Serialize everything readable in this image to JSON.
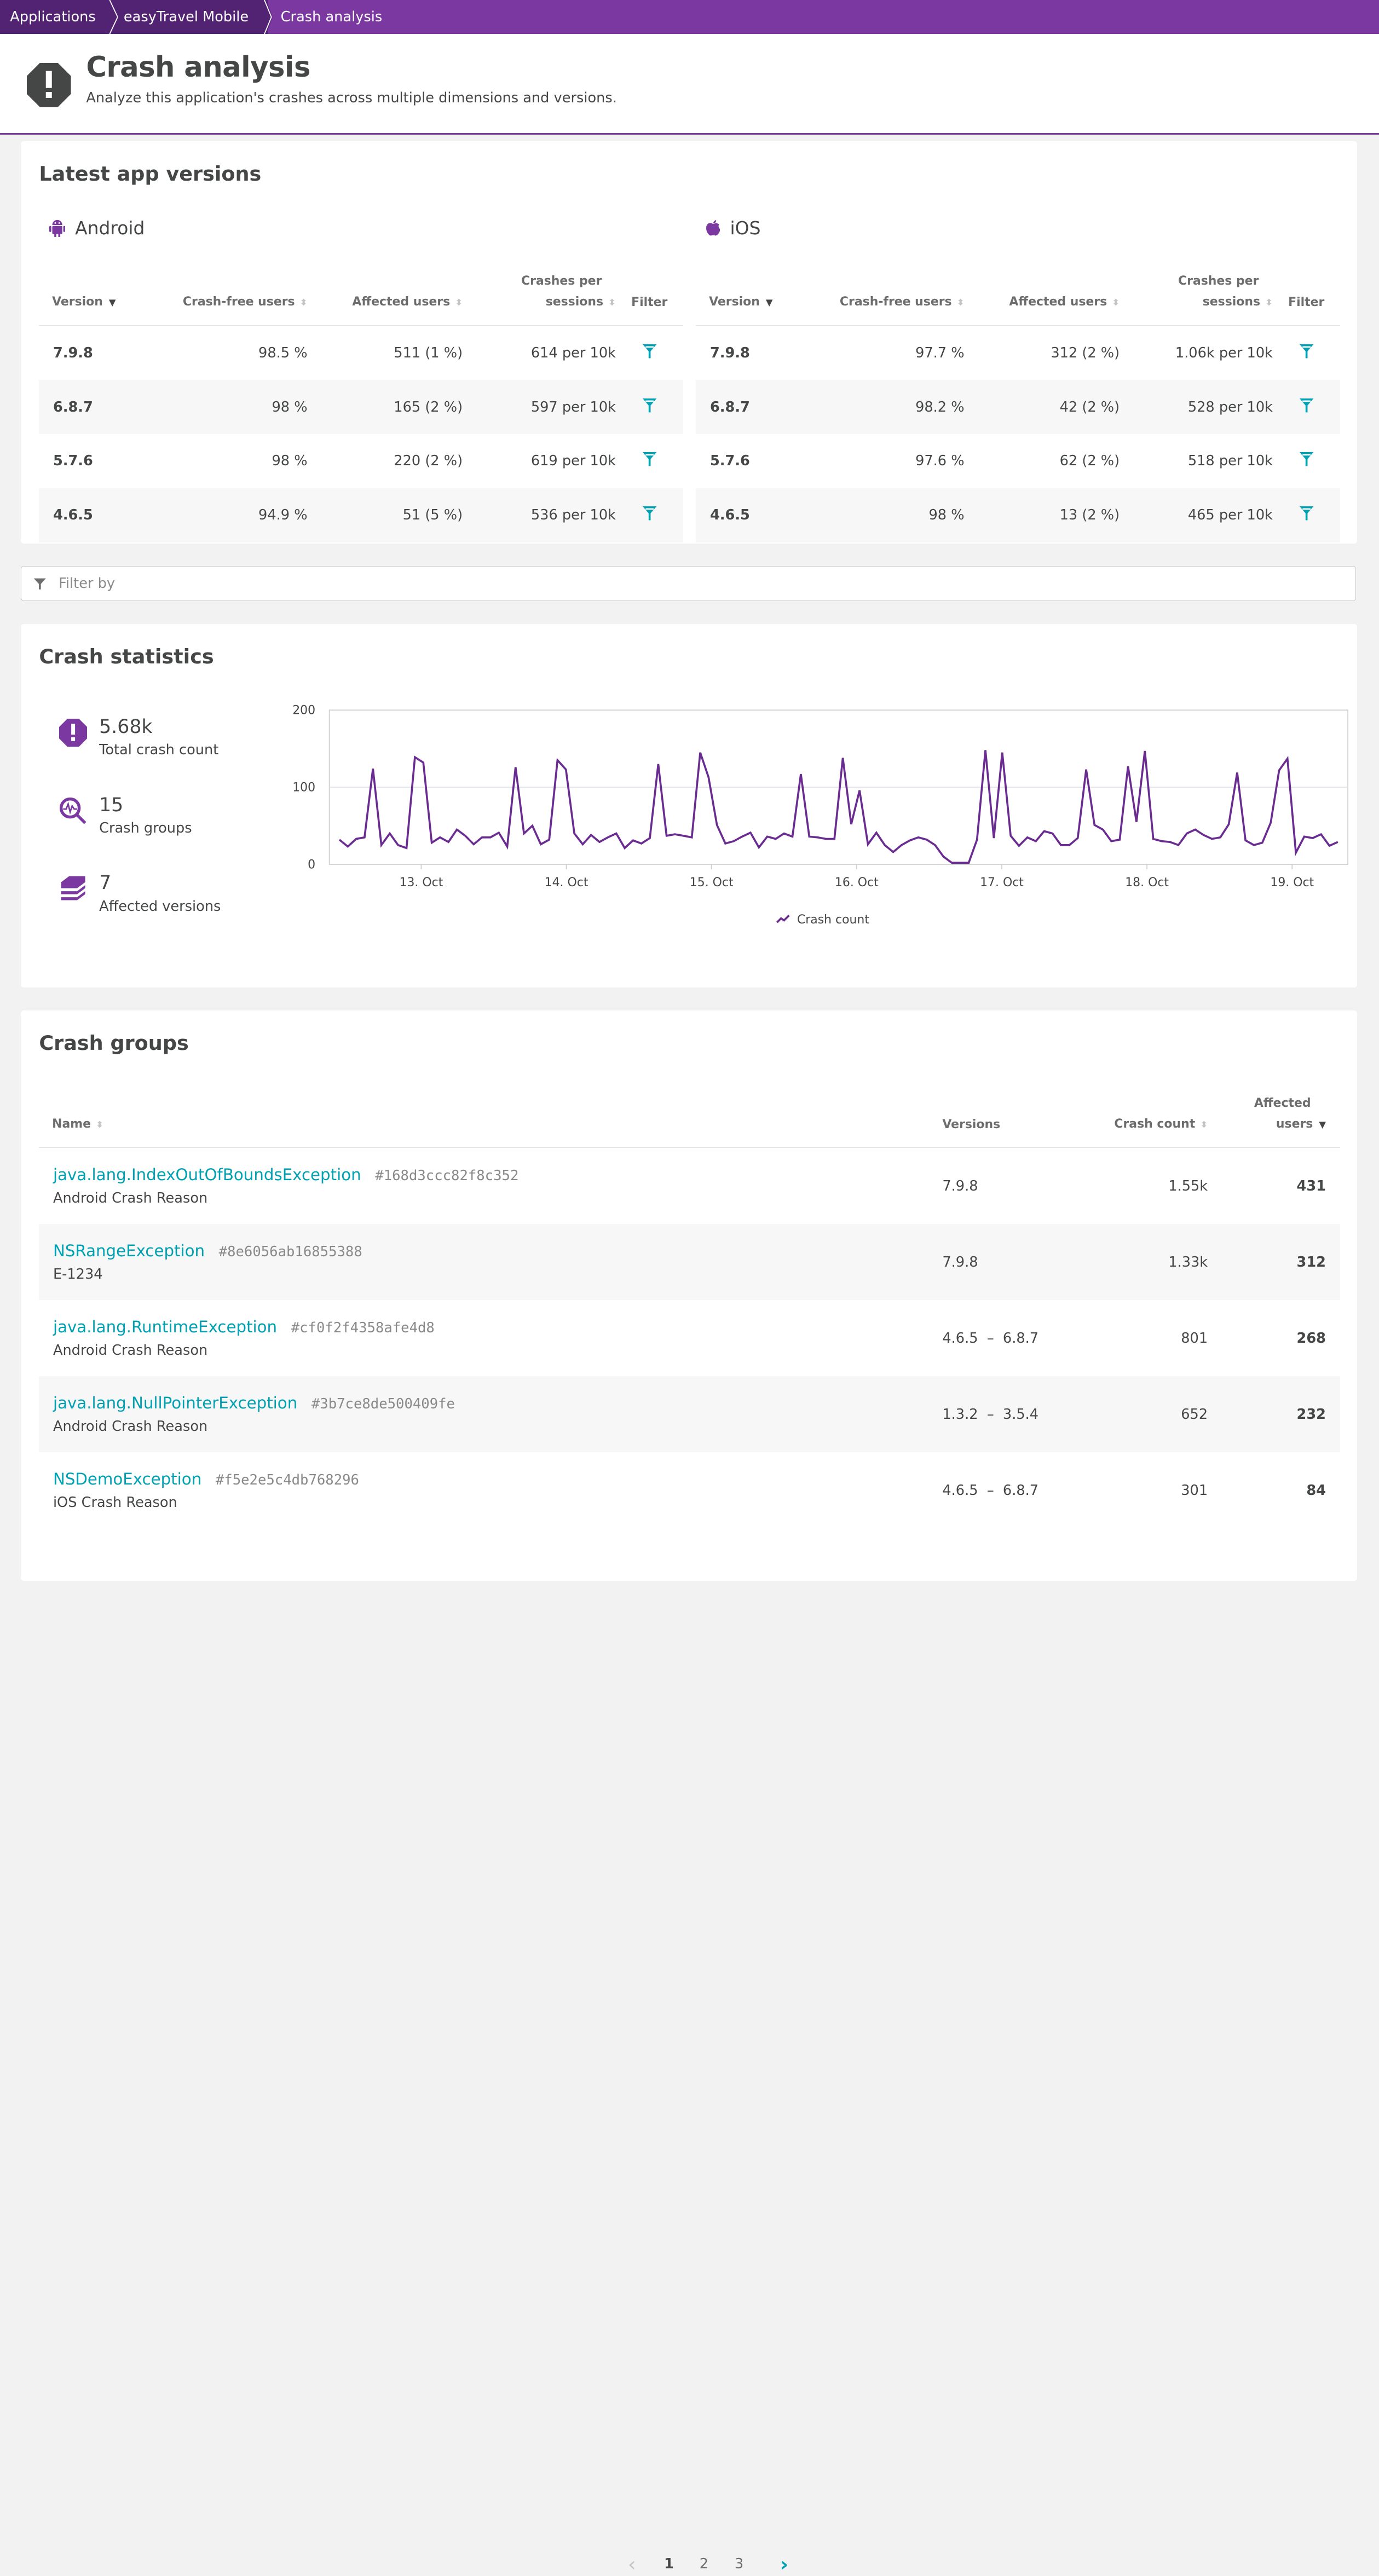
{
  "breadcrumb": [
    "Applications",
    "easyTravel Mobile",
    "Crash analysis"
  ],
  "header": {
    "title": "Crash analysis",
    "subtitle": "Analyze this application's crashes across multiple dimensions and versions."
  },
  "colors": {
    "brand": "#7c38a1",
    "brand_dark": "#522273",
    "link": "#00a1b2",
    "chart_line": "#6a2c91"
  },
  "latest_versions": {
    "title": "Latest app versions",
    "columns": [
      "Version",
      "Crash-free users",
      "Affected users",
      "Crashes per",
      "sessions",
      "Filter"
    ],
    "android": {
      "label": "Android",
      "rows": [
        {
          "version": "7.9.8",
          "crash_free": "98.5 %",
          "affected": "511 (1 %)",
          "per_sessions": "614 per 10k"
        },
        {
          "version": "6.8.7",
          "crash_free": "98 %",
          "affected": "165 (2 %)",
          "per_sessions": "597 per 10k"
        },
        {
          "version": "5.7.6",
          "crash_free": "98 %",
          "affected": "220 (2 %)",
          "per_sessions": "619 per 10k"
        },
        {
          "version": "4.6.5",
          "crash_free": "94.9 %",
          "affected": "51 (5 %)",
          "per_sessions": "536 per 10k"
        }
      ]
    },
    "ios": {
      "label": "iOS",
      "rows": [
        {
          "version": "7.9.8",
          "crash_free": "97.7 %",
          "affected": "312 (2 %)",
          "per_sessions": "1.06k per 10k"
        },
        {
          "version": "6.8.7",
          "crash_free": "98.2 %",
          "affected": "42 (2 %)",
          "per_sessions": "528 per 10k"
        },
        {
          "version": "5.7.6",
          "crash_free": "97.6 %",
          "affected": "62 (2 %)",
          "per_sessions": "518 per 10k"
        },
        {
          "version": "4.6.5",
          "crash_free": "98 %",
          "affected": "13 (2 %)",
          "per_sessions": "465 per 10k"
        }
      ]
    }
  },
  "filter": {
    "placeholder": "Filter by"
  },
  "crash_statistics": {
    "title": "Crash statistics",
    "kpis": [
      {
        "value": "5.68k",
        "label": "Total crash count",
        "icon": "crash-icon"
      },
      {
        "value": "15",
        "label": "Crash groups",
        "icon": "crash-group-search-icon"
      },
      {
        "value": "7",
        "label": "Affected versions",
        "icon": "versions-stack-icon"
      }
    ]
  },
  "chart_data": {
    "type": "line",
    "title": "",
    "xlabel": "",
    "ylabel": "",
    "ylim": [
      0,
      200
    ],
    "yticks": [
      0,
      100,
      200
    ],
    "grid": true,
    "legend": "bottom-center",
    "x_ticks": [
      {
        "label": "13. Oct",
        "index": 9.75
      },
      {
        "label": "14. Oct",
        "index": 27.05
      },
      {
        "label": "15. Oct",
        "index": 44.35
      },
      {
        "label": "16. Oct",
        "index": 61.65
      },
      {
        "label": "17. Oct",
        "index": 78.95
      },
      {
        "label": "18. Oct",
        "index": 96.25
      },
      {
        "label": "19. Oct",
        "index": 113.55
      }
    ],
    "series": [
      {
        "name": "Crash count",
        "values": [
          32,
          23,
          33,
          35,
          124,
          25,
          40,
          25,
          21,
          139,
          132,
          28,
          35,
          29,
          45,
          37,
          26,
          35,
          35,
          41,
          23,
          126,
          40,
          50,
          26,
          32,
          135,
          123,
          40,
          26,
          38,
          29,
          35,
          40,
          21,
          31,
          27,
          34,
          130,
          37,
          39,
          37,
          35,
          145,
          113,
          51,
          27,
          30,
          36,
          41,
          22,
          36,
          33,
          40,
          36,
          117,
          36,
          35,
          33,
          33,
          138,
          52,
          96,
          26,
          41,
          25,
          16,
          25,
          31,
          35,
          32,
          25,
          10,
          2,
          2,
          2,
          32,
          148,
          34,
          145,
          37,
          24,
          35,
          30,
          43,
          40,
          25,
          25,
          34,
          123,
          51,
          45,
          30,
          32,
          127,
          55,
          147,
          33,
          30,
          29,
          25,
          40,
          45,
          38,
          33,
          35,
          52,
          119,
          31,
          25,
          28,
          54,
          122,
          137,
          15,
          36,
          34,
          39,
          24,
          29
        ]
      }
    ]
  },
  "crash_groups": {
    "title": "Crash groups",
    "columns": {
      "name": "Name",
      "versions": "Versions",
      "crash_count": "Crash count",
      "affected_1": "Affected",
      "affected_2": "users"
    },
    "rows": [
      {
        "name": "java.lang.IndexOutOfBoundsException",
        "hash": "#168d3ccc82f8c352",
        "reason": "Android Crash Reason",
        "versions": "7.9.8",
        "crash_count": "1.55k",
        "affected": "431"
      },
      {
        "name": "NSRangeException",
        "hash": "#8e6056ab16855388",
        "reason": "E-1234",
        "versions": "7.9.8",
        "crash_count": "1.33k",
        "affected": "312"
      },
      {
        "name": "java.lang.RuntimeException",
        "hash": "#cf0f2f4358afe4d8",
        "reason": "Android Crash Reason",
        "versions": "4.6.5  –  6.8.7",
        "crash_count": "801",
        "affected": "268"
      },
      {
        "name": "java.lang.NullPointerException",
        "hash": "#3b7ce8de500409fe",
        "reason": "Android Crash Reason",
        "versions": "1.3.2  –  3.5.4",
        "crash_count": "652",
        "affected": "232"
      },
      {
        "name": "NSDemoException",
        "hash": "#f5e2e5c4db768296",
        "reason": "iOS Crash Reason",
        "versions": "4.6.5  –  6.8.7",
        "crash_count": "301",
        "affected": "84"
      }
    ]
  },
  "pagination": {
    "pages": [
      "1",
      "2",
      "3"
    ],
    "current": "1"
  }
}
